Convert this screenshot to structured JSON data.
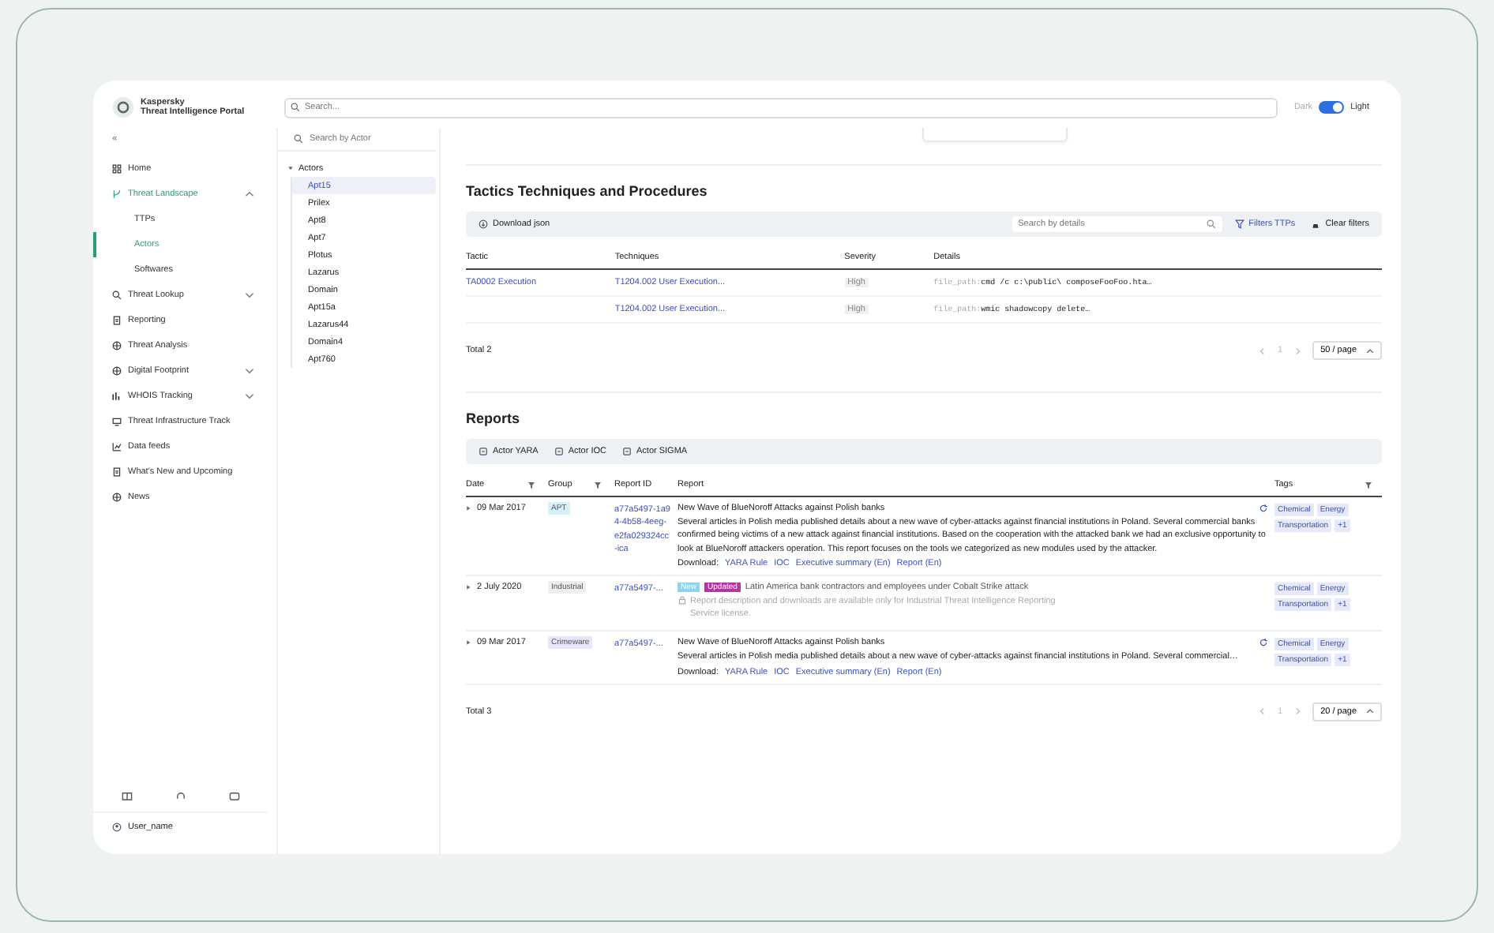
{
  "header": {
    "logo_lines": [
      "Kaspersky",
      "Threat Intelligence Portal"
    ],
    "search_placeholder": "Search...",
    "theme": {
      "left_label": "Dark",
      "right_label": "Light",
      "on": true
    }
  },
  "sidebar": {
    "collapse": "«",
    "items": [
      {
        "label": "Home",
        "selected": false
      },
      {
        "label": "Threat Landscape",
        "selected": true,
        "expanded": true,
        "children": [
          {
            "label": "TTPs",
            "selected": false
          },
          {
            "label": "Actors",
            "selected": true
          },
          {
            "label": "Softwares",
            "selected": false
          }
        ]
      },
      {
        "label": "Threat Lookup",
        "selected": false,
        "expanded": false
      },
      {
        "label": "Reporting",
        "selected": false
      },
      {
        "label": "Threat Analysis",
        "selected": false
      },
      {
        "label": "Digital Footprint",
        "selected": false,
        "expanded": false
      },
      {
        "label": "WHOIS Tracking",
        "selected": false,
        "expanded": false
      },
      {
        "label": "Threat Infrastructure Track",
        "selected": false
      },
      {
        "label": "Data feeds",
        "selected": false
      },
      {
        "label": "What's New and Upcoming",
        "selected": false
      },
      {
        "label": "News",
        "selected": false
      }
    ],
    "user": "User_name"
  },
  "actors": {
    "search_placeholder": "Search by Actor",
    "root": {
      "label": "Actors",
      "expanded": true,
      "children": [
        {
          "label": "Apt15",
          "selected": true
        },
        {
          "label": "Prilex",
          "selected": false
        },
        {
          "label": "Apt8",
          "selected": false
        },
        {
          "label": "Apt7",
          "selected": false
        },
        {
          "label": "Plotus",
          "selected": false
        },
        {
          "label": "Lazarus",
          "selected": false
        },
        {
          "label": "Domain",
          "selected": false
        },
        {
          "label": "Apt15a",
          "selected": false
        },
        {
          "label": "Lazarus44",
          "selected": false
        },
        {
          "label": "Domain4",
          "selected": false
        },
        {
          "label": "Apt760",
          "selected": false
        }
      ]
    }
  },
  "ttp": {
    "title": "Tactics Techniques and Procedures",
    "download": "Download json",
    "search_placeholder": "Search by details",
    "filters": "Filters TTPs",
    "clear": "Clear filters",
    "columns": [
      "Tactic",
      "Techniques",
      "Severity",
      "Details"
    ],
    "rows": [
      {
        "tactic": "TA0002 Execution",
        "technique": "T1204.002 User Execution...",
        "severity": "High",
        "detail_key": "file_path:",
        "detail_value": "cmd /c c:\\public\\ composeFooFoo.hta…"
      },
      {
        "tactic": "",
        "technique": "T1204.002 User Execution...",
        "severity": "High",
        "detail_key": "file_path:",
        "detail_value": "wmic shadowcopy delete…"
      }
    ],
    "total": "Total 2",
    "page": "1",
    "page_size": "50 / page"
  },
  "reports": {
    "title": "Reports",
    "tools": [
      "Actor YARA",
      "Actor IOC",
      "Actor SIGMA"
    ],
    "columns": [
      {
        "label": "Date",
        "filter": true
      },
      {
        "label": "Group",
        "filter": true
      },
      {
        "label": "Report ID",
        "filter": false
      },
      {
        "label": "Report",
        "filter": false
      },
      {
        "label": "Tags",
        "filter": true
      }
    ],
    "rows": [
      {
        "date": "09 Mar 2017",
        "group": "APT",
        "color": "#d6f1f7",
        "report_id": "a77a5497-1a94-4b58-4eeg-e2fa029324cc-ica",
        "locked": false,
        "badges": [],
        "title": "New Wave of BlueNoroff Attacks against Polish banks",
        "description": "Several articles in Polish media published details about a new wave of cyber-attacks against financial institutions in Poland. Several commercial banks confirmed being victims of a new attack against financial institutions. Based on the cooperation with the attacked bank we had an exclusive opportunity to look at BlueNoroff attackers operation. This report focuses on the tools we categorized as new modules used by the attacker.",
        "download_label": "Download:",
        "downloads": [
          "YARA Rule",
          "IOC",
          "Executive summary (En)",
          "Report (En)"
        ],
        "tags": [
          "Chemical",
          "Energy",
          "Transportation",
          "+1"
        ]
      },
      {
        "date": "2 July 2020",
        "group": "Industrial",
        "color": "#eeeeee",
        "report_id": "a77a5497-...",
        "locked": true,
        "badges": [
          {
            "label": "New",
            "color": "#8fd3ea"
          },
          {
            "label": "Updated",
            "color": "#b0389c"
          }
        ],
        "title": "Latin America bank contractors and employees under Cobalt Strike attack",
        "description": "Report description and downloads are available only for Industrial Threat Intelligence Reporting Service license.",
        "tags": [
          "Chemical",
          "Energy",
          "Transportation",
          "+1"
        ]
      },
      {
        "date": "09 Mar 2017",
        "group": "Crimeware",
        "color": "#e6e6fa",
        "report_id": "a77a5497-...",
        "locked": false,
        "badges": [],
        "title": "New Wave of BlueNoroff Attacks against Polish banks",
        "description": "Several articles in Polish media published details about a new wave of cyber-attacks against financial institutions in Poland. Several commercial…",
        "download_label": "Download:",
        "downloads": [
          "YARA Rule",
          "IOC",
          "Executive summary (En)",
          "Report (En)"
        ],
        "tags": [
          "Chemical",
          "Energy",
          "Transportation",
          "+1"
        ]
      }
    ],
    "total": "Total 3",
    "page": "1",
    "page_size": "20 / page"
  }
}
